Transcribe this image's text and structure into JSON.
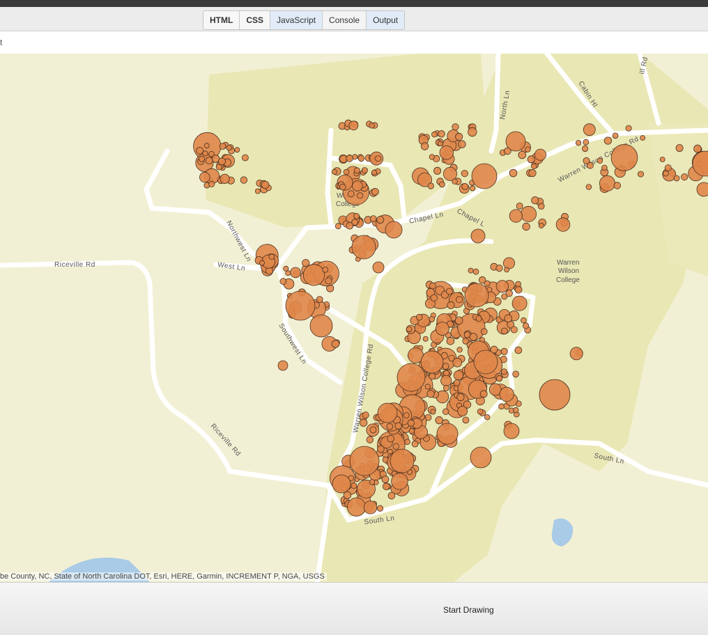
{
  "tabs": [
    {
      "label": "HTML",
      "style": "bold"
    },
    {
      "label": "CSS",
      "style": "bold"
    },
    {
      "label": "JavaScript",
      "style": "active"
    },
    {
      "label": "Console",
      "style": ""
    },
    {
      "label": "Output",
      "style": "active"
    }
  ],
  "urlbar": {
    "text": "t"
  },
  "map": {
    "attribution": "be County, NC, State of North Carolina DOT, Esri, HERE, Garmin, INCREMENT P, NGA, USGS",
    "road_labels": {
      "riceville_rd_1": "Riceville Rd",
      "riceville_rd_2": "Riceville Rd",
      "northwest_ln": "Northwest Ln",
      "west_ln": "West Ln",
      "southwest_ln": "Southwest Ln",
      "chapel_ln_1": "Chapel Ln",
      "chapel_ln_2": "Chapel L",
      "north_ln": "North Ln",
      "cabin_hl": "Cabin Hl",
      "warren_wilson_college_rd_1": "Warren Wilson College Rd",
      "warren_wilson_college_rd_2": "Warren Wilson College Rd",
      "south_ln_1": "South Ln",
      "south_ln_2": "South Ln",
      "hill_rd": "ill Rd"
    },
    "place_labels": {
      "college_1_line1": "Wilson",
      "college_1_line2": "College",
      "college_2_line1": "Warren",
      "college_2_line2": "Wilson",
      "college_2_line3": "College"
    },
    "colors": {
      "background": "#f2f0d4",
      "campus": "#e9e7b4",
      "road": "#ffffff",
      "water": "#a9cbe7",
      "point_fill": "#e0874a",
      "point_stroke": "#4a3020"
    }
  },
  "buttons": {
    "start_drawing": "Start Drawing"
  }
}
